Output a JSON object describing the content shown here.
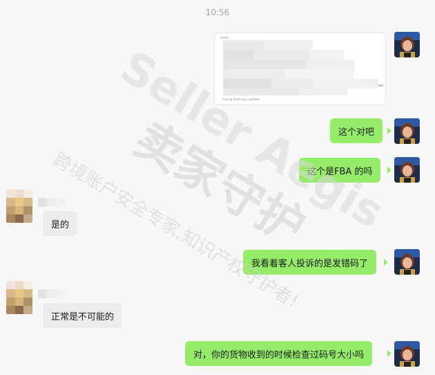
{
  "chat": {
    "timestamp": "10:56",
    "messages": [
      {
        "side": "self",
        "type": "image"
      },
      {
        "side": "self",
        "type": "text",
        "text": "这个对吧"
      },
      {
        "side": "self",
        "type": "text",
        "text": "这个是FBA 的吗"
      },
      {
        "side": "other",
        "type": "text",
        "text": "是的"
      },
      {
        "side": "self",
        "type": "text",
        "text": "我看着客人投诉的是发错码了"
      },
      {
        "side": "other",
        "type": "text",
        "text": "正常是不可能的"
      },
      {
        "side": "self",
        "type": "text",
        "text": "对，你的货物收到的时候检查过码号大小吗"
      }
    ],
    "image_caption": "Listing Draft copy updates"
  },
  "watermark": {
    "brand": "Seller Aegis",
    "title": "卖家守护",
    "slogan": "跨境账户安全专家,知识产权守护者!"
  },
  "colors": {
    "background": "#f7f7f7",
    "self_bubble": "#95ec69",
    "other_bubble": "#ececec"
  }
}
